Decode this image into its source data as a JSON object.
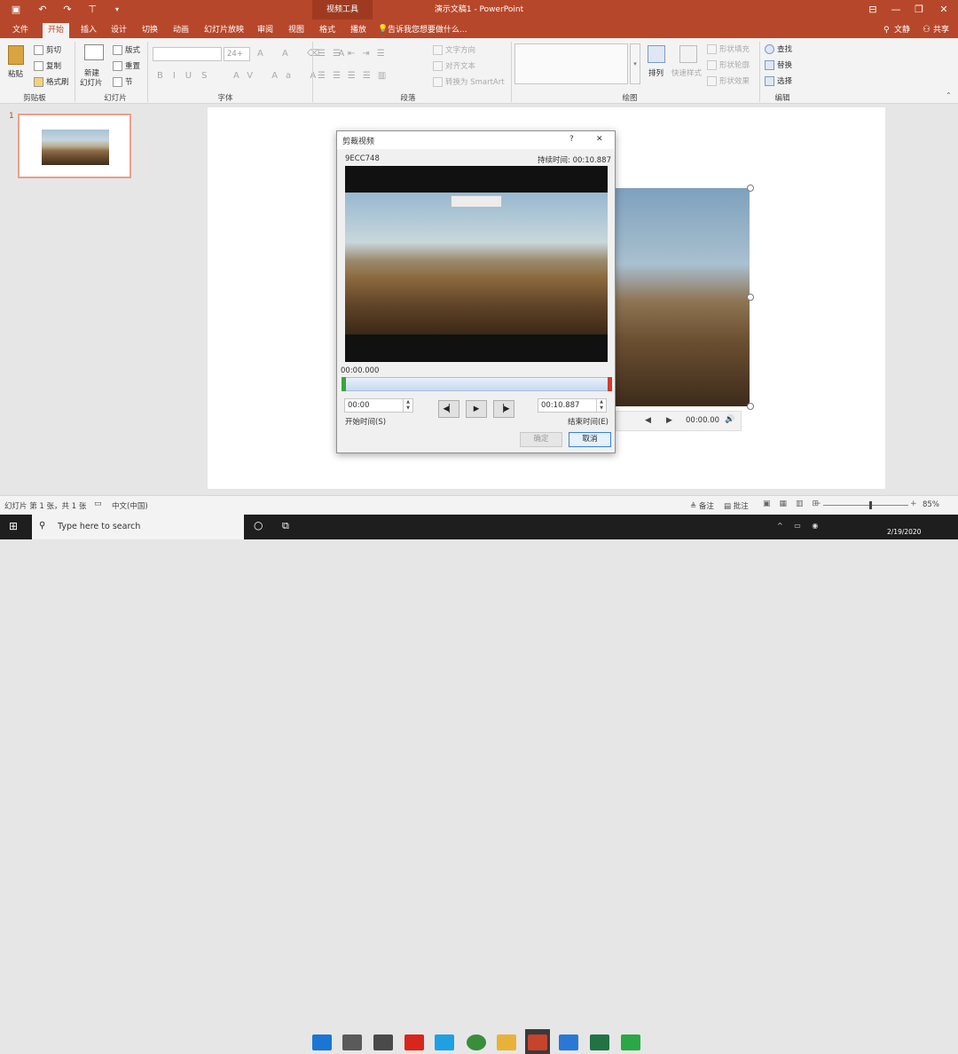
{
  "window": {
    "title": "演示文稿1 - PowerPoint",
    "context_tab_group": "视频工具"
  },
  "tabs": [
    {
      "label": "文件"
    },
    {
      "label": "开始"
    },
    {
      "label": "插入"
    },
    {
      "label": "设计"
    },
    {
      "label": "切换"
    },
    {
      "label": "动画"
    },
    {
      "label": "幻灯片放映"
    },
    {
      "label": "审阅"
    },
    {
      "label": "视图"
    },
    {
      "label": "格式"
    },
    {
      "label": "播放"
    }
  ],
  "tell_me": "告诉我您想要做什么...",
  "account": {
    "user": "文静",
    "share": "共享"
  },
  "ribbon": {
    "clipboard": {
      "paste": "粘贴",
      "cut": "剪切",
      "copy": "复制",
      "format_painter": "格式刷",
      "group": "剪贴板"
    },
    "slides": {
      "new_slide": "新建\n幻灯片",
      "new_slide_1": "新建",
      "new_slide_2": "幻灯片",
      "layout": "版式",
      "reset": "重置",
      "section": "节",
      "group": "幻灯片"
    },
    "font": {
      "size": "24+",
      "group": "字体"
    },
    "paragraph": {
      "text_direction": "文字方向",
      "align_text": "对齐文本",
      "smartart": "转换为 SmartArt",
      "group": "段落"
    },
    "drawing": {
      "arrange": "排列",
      "quick_styles": "快速样式",
      "shape_fill": "形状填充",
      "shape_outline": "形状轮廓",
      "shape_effects": "形状效果",
      "group": "绘图"
    },
    "editing": {
      "find": "查找",
      "replace": "替换",
      "select": "选择",
      "group": "编辑"
    }
  },
  "thumbnail": {
    "number": "1"
  },
  "slide_player": {
    "time": "00:00.00"
  },
  "dialog": {
    "title": "剪裁视频",
    "help": "?",
    "close": "✕",
    "video_name": "9ECC748",
    "duration": "持续时间: 00:10.887",
    "current_time": "00:00.000",
    "start_value": "00:00",
    "start_label": "开始时间(S)",
    "end_value": "00:10.887",
    "end_label": "结束时间(E)",
    "ok": "确定",
    "cancel": "取消"
  },
  "status": {
    "slide_info": "幻灯片 第 1 张，共 1 张",
    "language": "中文(中国)",
    "notes": "备注",
    "comments": "批注",
    "zoom": "85%"
  },
  "taskbar": {
    "search_placeholder": "Type here to search",
    "date": "2/19/2020"
  },
  "colors": {
    "accent": "#b7472a",
    "taskbar": "#1e1e1e",
    "dialog_bg": "#f0f0f0"
  }
}
